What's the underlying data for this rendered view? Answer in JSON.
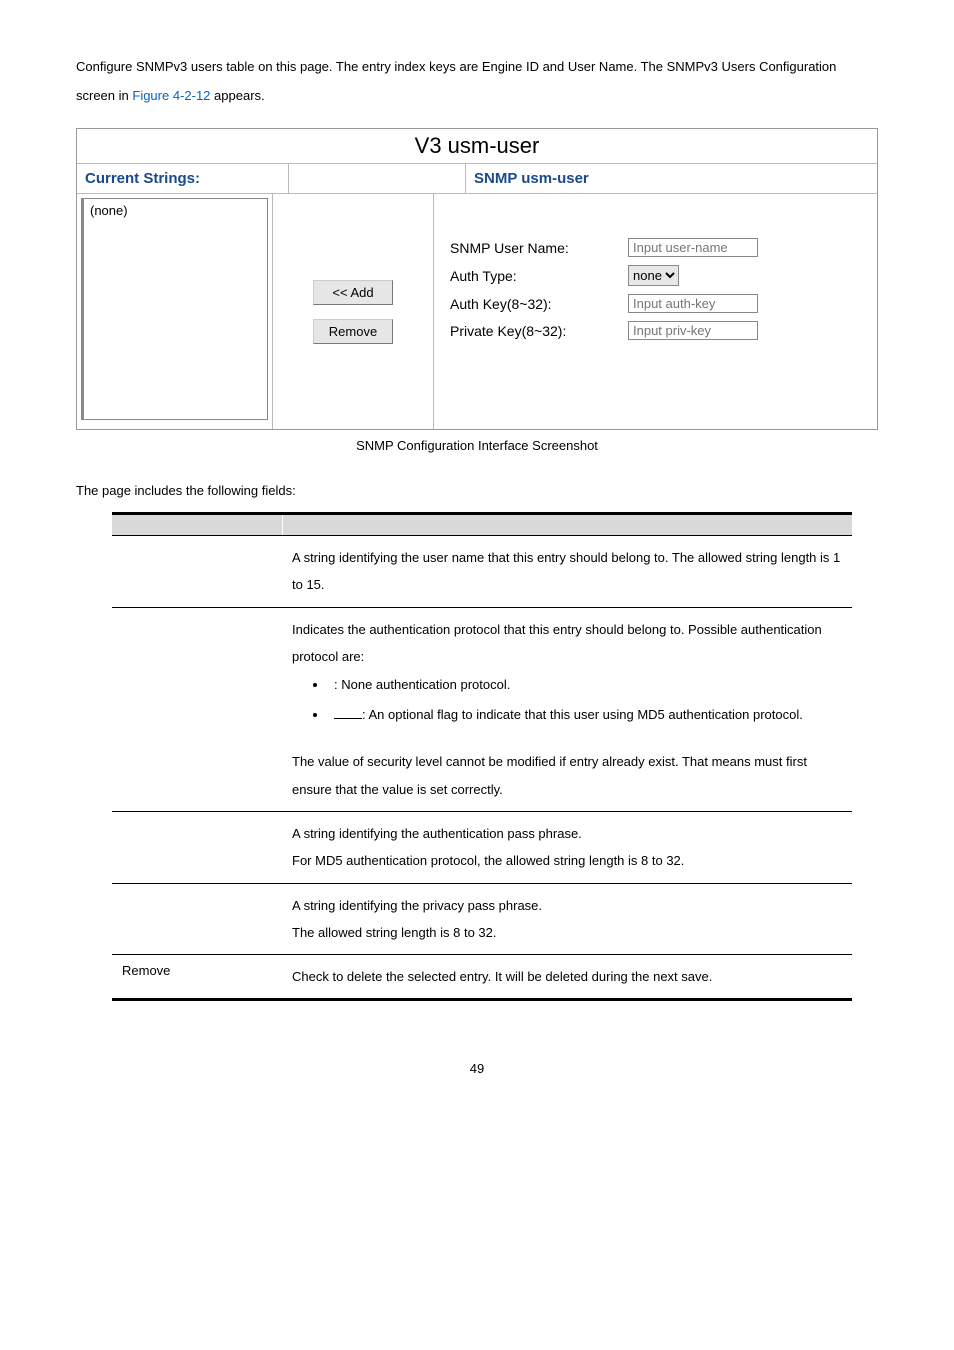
{
  "intro": {
    "text1": "Configure SNMPv3 users table on this page. The entry index keys are Engine ID and User Name. The SNMPv3 Users Configuration screen in ",
    "figref": "Figure 4-2-12",
    "text2": " appears."
  },
  "panel": {
    "title": "V3 usm-user",
    "left_header": "Current Strings:",
    "right_header": "SNMP usm-user",
    "none_item": "(none)",
    "buttons": {
      "add": "<< Add",
      "remove": "Remove"
    },
    "form": {
      "username_label": "SNMP User Name:",
      "username_placeholder": "Input user-name",
      "authtype_label": "Auth Type:",
      "authtype_value": "none",
      "authkey_label": "Auth Key(8~32):",
      "authkey_placeholder": "Input auth-key",
      "privkey_label": "Private Key(8~32):",
      "privkey_placeholder": "Input priv-key"
    }
  },
  "caption": "SNMP Configuration Interface Screenshot",
  "fields_intro": "The page includes the following fields:",
  "table": {
    "rows": [
      {
        "desc1": "A string identifying the user name that this entry should belong to. The allowed string length is 1 to 15."
      },
      {
        "desc_intro": "Indicates the authentication protocol that this entry should belong to. Possible authentication protocol are:",
        "bullet1_tail": ": None authentication protocol.",
        "bullet2_tail": ": An optional flag to indicate that this user using MD5 authentication protocol.",
        "desc_out": "The value of security level cannot be modified if entry already exist. That means must first ensure that the value is set correctly."
      },
      {
        "line1": "A string identifying the authentication pass phrase.",
        "line2": "For MD5 authentication protocol, the allowed string length is 8 to 32."
      },
      {
        "line1": "A string identifying the privacy pass phrase.",
        "line2": "The allowed string length is 8 to 32."
      },
      {
        "obj": "Remove",
        "line1": "Check to delete the selected entry. It will be deleted during the next save."
      }
    ]
  },
  "page_number": "49"
}
